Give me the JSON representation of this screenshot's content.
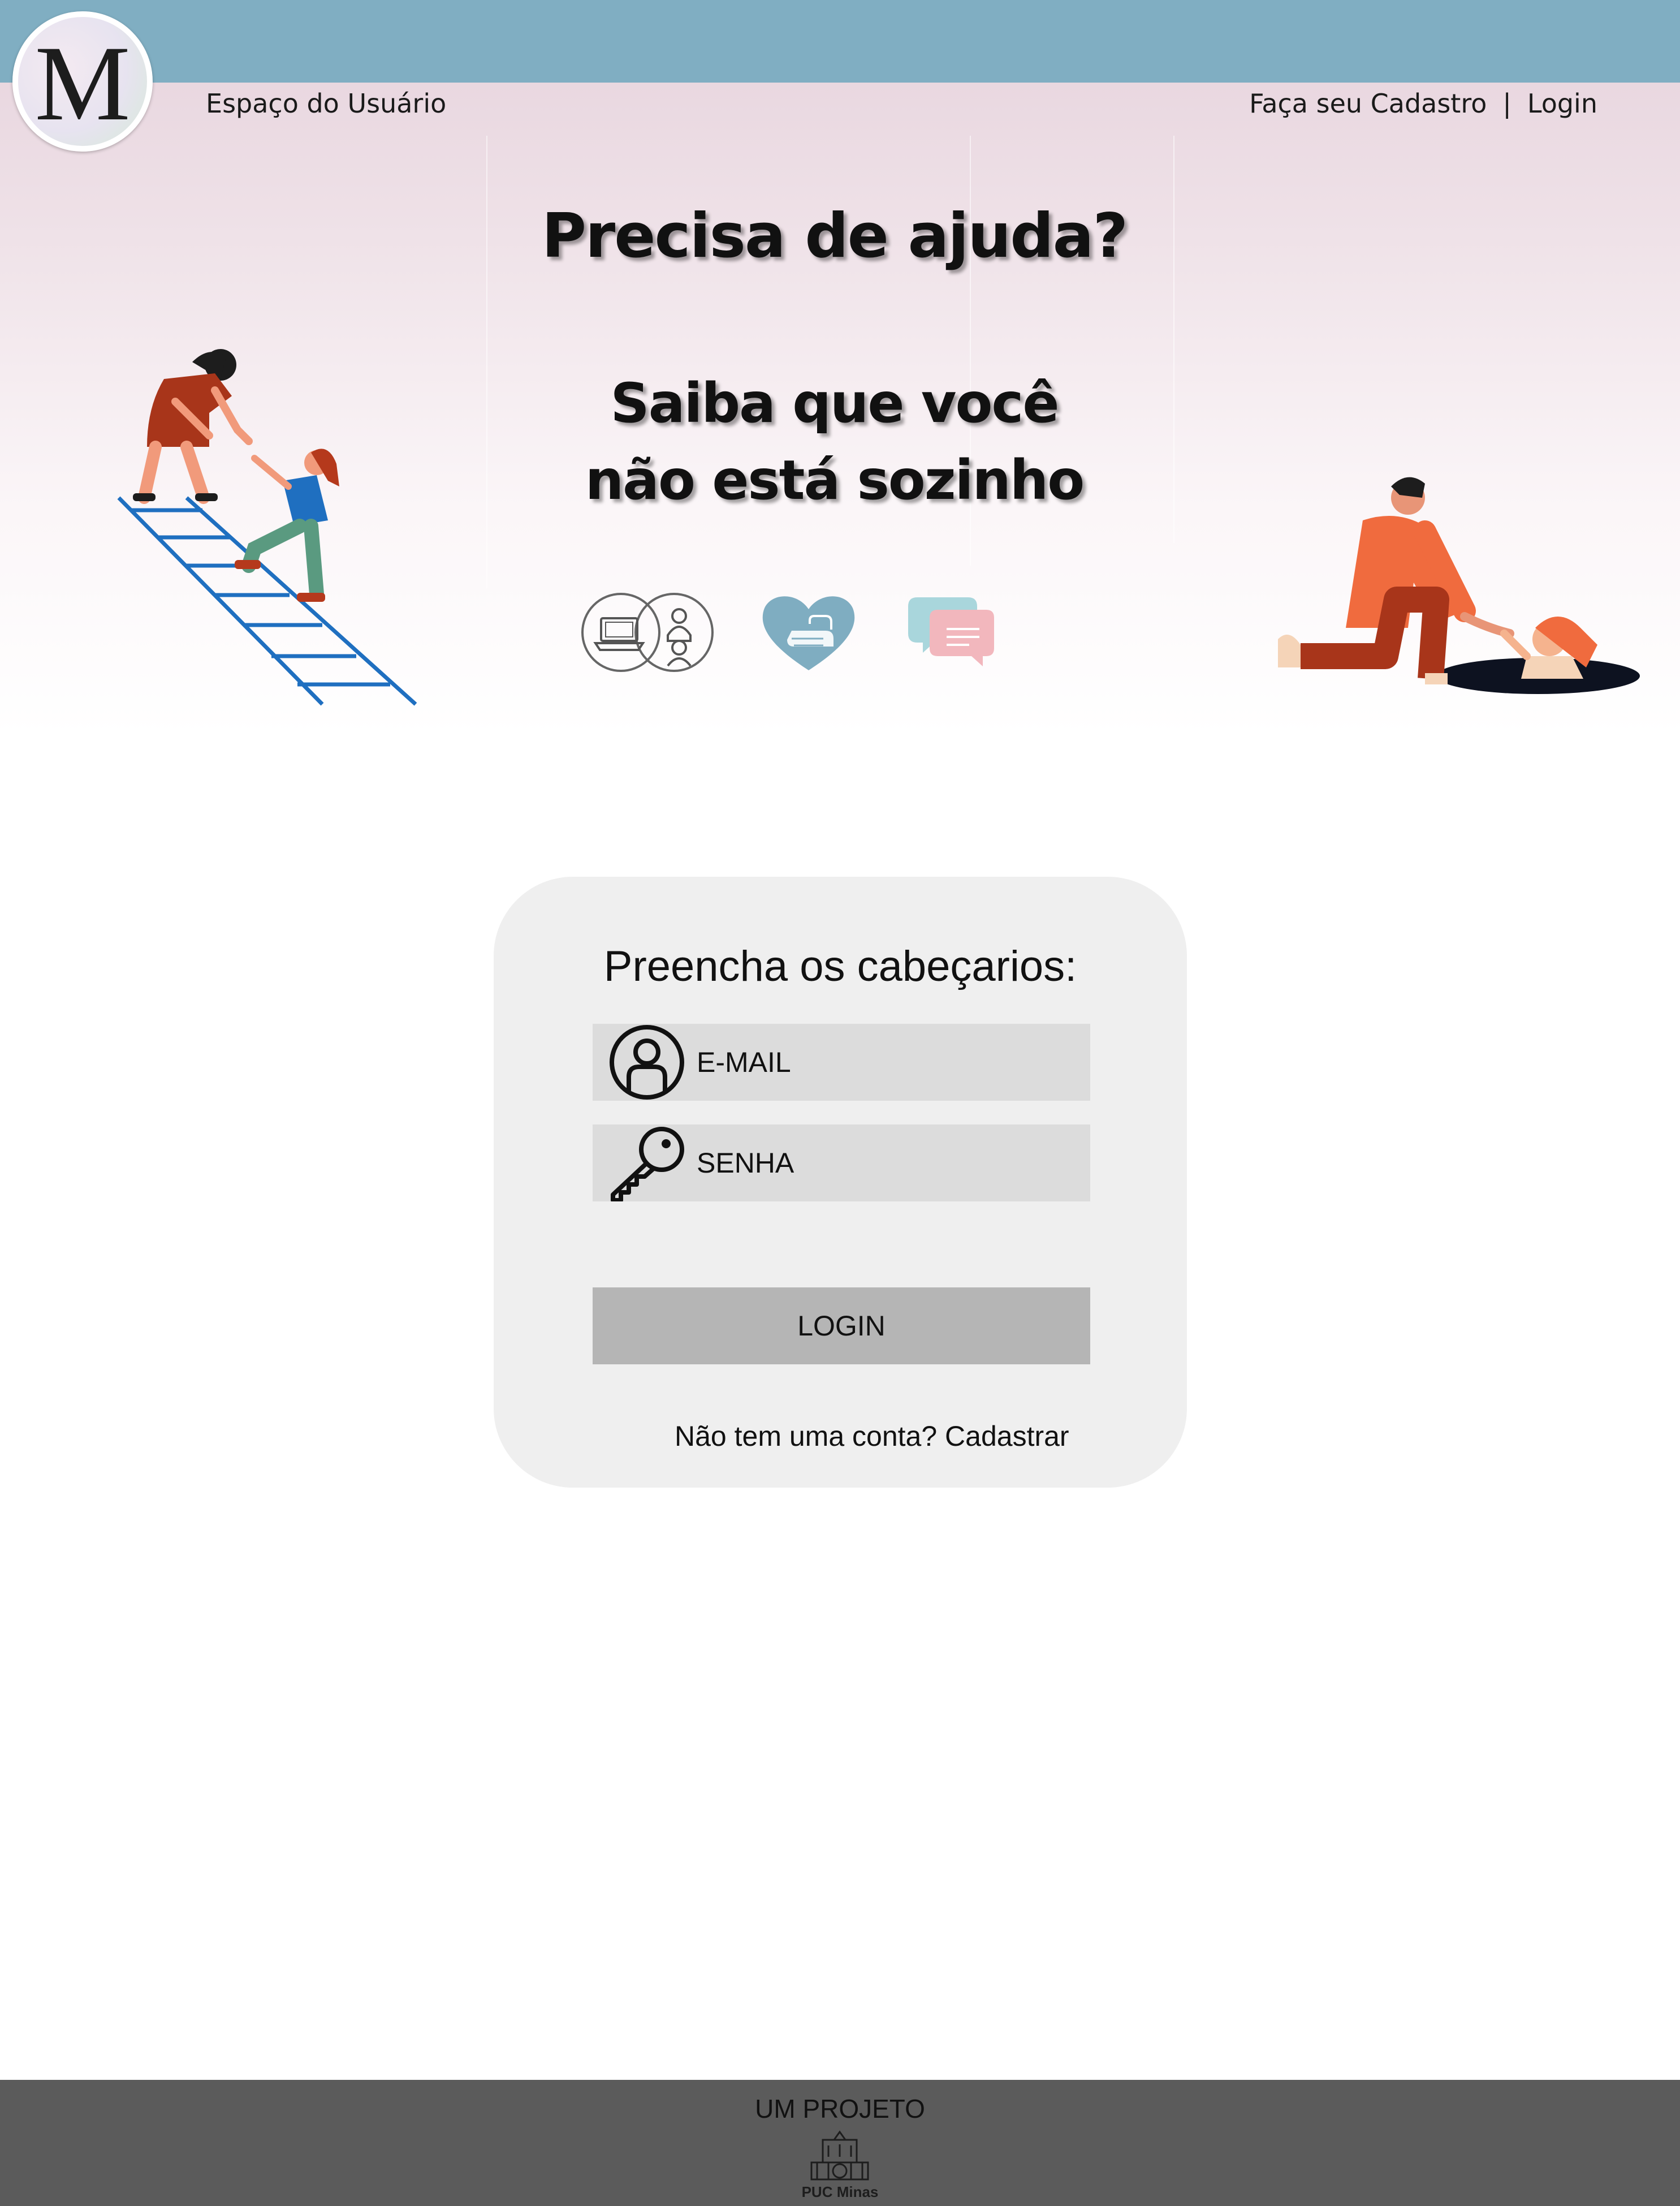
{
  "header": {
    "logo_letter": "M",
    "user_space_label": "Espaço do Usuário",
    "signup_link": "Faça seu Cadastro",
    "separator": "|",
    "login_link": "Login"
  },
  "hero": {
    "title": "Precisa de ajuda?",
    "subtitle_line1": "Saiba que você",
    "subtitle_line2": "não está sozinho",
    "icons": [
      "online-consultation-icon",
      "heart-hands-icon",
      "chat-bubbles-icon"
    ],
    "illustrations": [
      "woman-helping-climb-ladder",
      "man-pulling-woman-from-hole"
    ]
  },
  "login_form": {
    "title": "Preencha os cabeçarios:",
    "email_placeholder": "E-MAIL",
    "password_placeholder": "SENHA",
    "submit_label": "LOGIN",
    "no_account_text": "Não tem uma conta?",
    "register_link": "Cadastrar"
  },
  "footer": {
    "project_label": "UM PROJETO",
    "institution": "PUC Minas"
  },
  "colors": {
    "topbar": "#80aec2",
    "hero_top": "#e6d2dc",
    "card_bg": "#efefef",
    "field_bg": "#dcdcdc",
    "button_bg": "#b5b5b5",
    "footer_bg": "#5b5b5b"
  }
}
